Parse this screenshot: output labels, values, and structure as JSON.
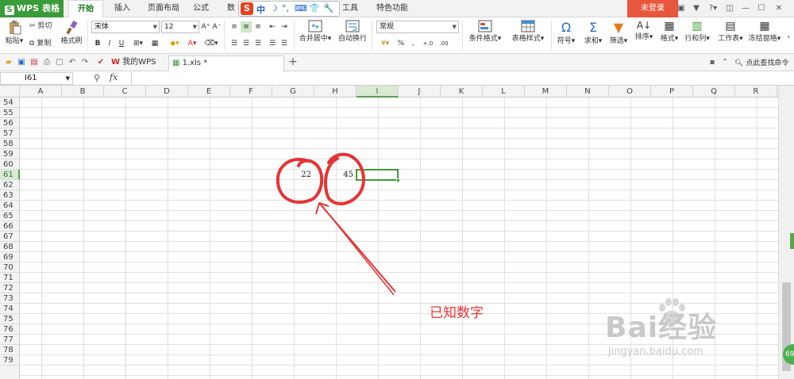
{
  "titlebar": {
    "app_name": "WPS 表格",
    "tabs": [
      "开始",
      "插入",
      "页面布局",
      "公式",
      "数",
      "工具",
      "特色功能"
    ],
    "active_tab": "开始",
    "ime": {
      "logo": "S",
      "mode": "中"
    },
    "login_label": "未登录"
  },
  "ribbon": {
    "paste": "粘贴",
    "cut": "剪切",
    "copy": "复制",
    "format_painter": "格式刷",
    "font_name": "宋体",
    "font_size": "12",
    "merge_center": "合并居中",
    "wrap_text": "自动换行",
    "number_format": "常规",
    "conditional_format": "条件格式",
    "table_style": "表格样式",
    "symbol": "符号",
    "sum": "求和",
    "filter": "筛选",
    "sort": "排序",
    "format": "格式",
    "rows_cols": "行和列",
    "worksheet": "工作表",
    "freeze": "冻结窗格"
  },
  "tabbar": {
    "my_wps": "我的WPS",
    "file_tab": "1.xls *",
    "search_cmd": "点此查找命令"
  },
  "formula_bar": {
    "cell_ref": "I61",
    "fx": "fx",
    "content": ""
  },
  "sheet": {
    "columns": [
      "A",
      "B",
      "C",
      "D",
      "E",
      "F",
      "G",
      "H",
      "I",
      "J",
      "K",
      "L",
      "M",
      "N",
      "O",
      "P",
      "Q",
      "R"
    ],
    "selected_column": "I",
    "rows": [
      "54",
      "55",
      "56",
      "57",
      "58",
      "59",
      "60",
      "61",
      "62",
      "63",
      "64",
      "65",
      "66",
      "67",
      "68",
      "69",
      "70",
      "71",
      "72",
      "73",
      "74",
      "75",
      "76",
      "77",
      "78",
      "79"
    ],
    "selected_row": "61",
    "cells": {
      "G61": "22",
      "H61": "45"
    }
  },
  "annotation": {
    "label": "已知数字",
    "color": "#e63434"
  },
  "watermark": {
    "brand": "Bai经验",
    "url": "jingyan.baidu.com"
  },
  "badge": "69",
  "colors": {
    "accent": "#3a9b3a",
    "login": "#e8563d",
    "selection": "#3f9a37"
  }
}
